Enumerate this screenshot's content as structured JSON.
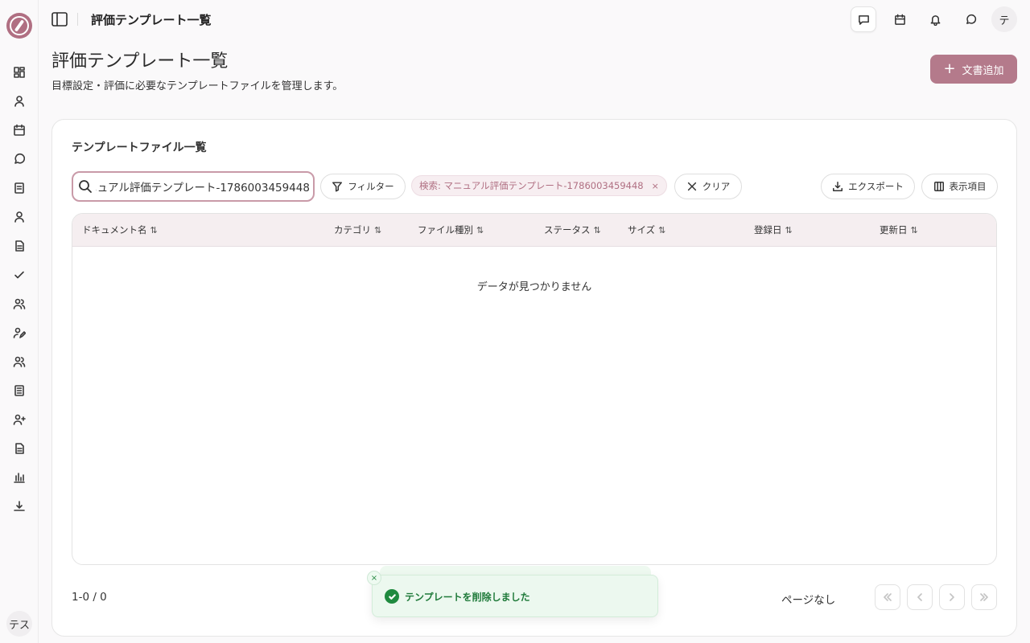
{
  "header": {
    "title": "評価テンプレート一覧",
    "avatar_initial": "テ"
  },
  "sidebar": {
    "items": [
      {
        "icon": "dashboard-icon"
      },
      {
        "icon": "user-icon"
      },
      {
        "icon": "calendar-icon"
      },
      {
        "icon": "chat-icon"
      },
      {
        "icon": "document-list-icon"
      },
      {
        "icon": "person-icon"
      },
      {
        "icon": "file-icon"
      },
      {
        "icon": "check-icon"
      },
      {
        "icon": "users-icon"
      },
      {
        "icon": "user-edit-icon"
      },
      {
        "icon": "team-icon"
      },
      {
        "icon": "notebook-icon"
      },
      {
        "icon": "user-plus-icon"
      },
      {
        "icon": "file-text-icon"
      },
      {
        "icon": "bar-chart-icon"
      },
      {
        "icon": "download-icon"
      }
    ],
    "user_avatar": "テス"
  },
  "page": {
    "title": "評価テンプレート一覧",
    "subtitle": "目標設定・評価に必要なテンプレートファイルを管理します。",
    "add_button": "文書追加"
  },
  "card": {
    "title": "テンプレートファイル一覧",
    "search_value": "マニュアル評価テンプレート-1786003459448",
    "filter_label": "フィルター",
    "chip_label": "検索: マニュアル評価テンプレート-1786003459448",
    "chip_close": "×",
    "clear_label": "クリア",
    "export_label": "エクスポート",
    "columns_label": "表示項目"
  },
  "table": {
    "columns": [
      "ドキュメント名",
      "カテゴリ",
      "ファイル種別",
      "ステータス",
      "サイズ",
      "登録日",
      "更新日"
    ],
    "sort_glyph": "⇅",
    "empty_message": "データが見つかりません"
  },
  "pagination": {
    "count": "1-0 / 0",
    "page_label": "ページなし"
  },
  "toast": {
    "message": "テンプレートを削除しました",
    "close": "×"
  },
  "colors": {
    "accent": "#b47a8b",
    "success": "#1f8a3f"
  }
}
